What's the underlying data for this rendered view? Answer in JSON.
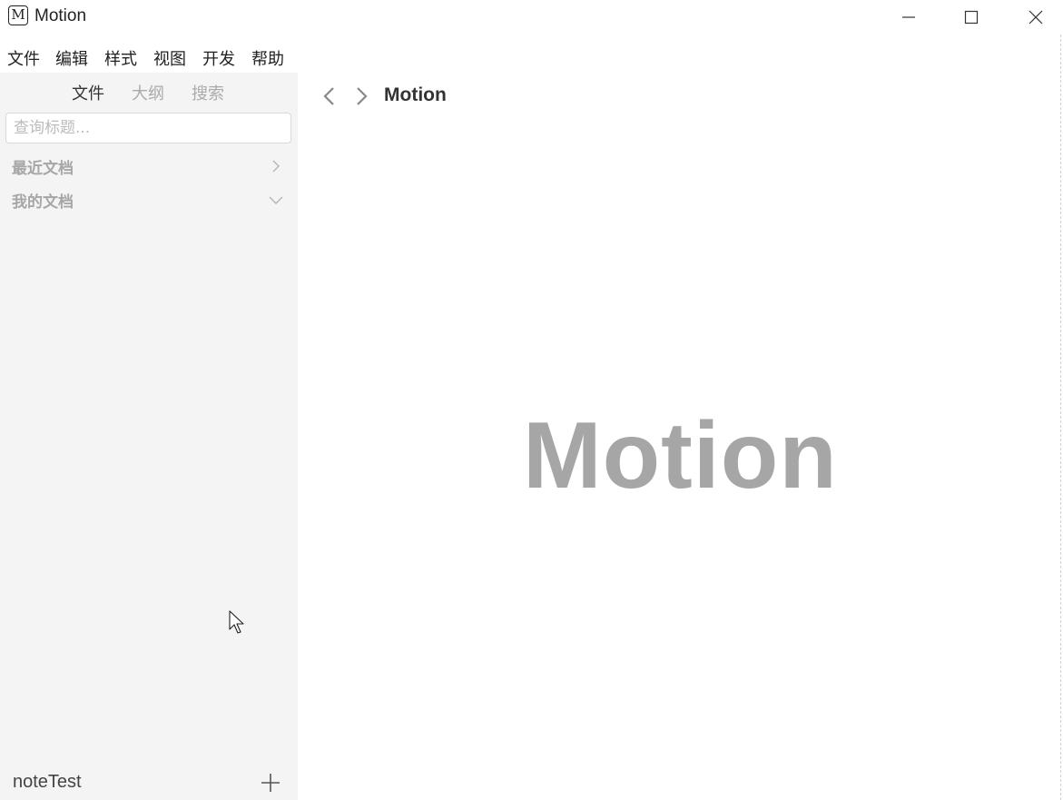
{
  "window": {
    "app_icon_letter": "M",
    "title": "Motion"
  },
  "menu": {
    "items": [
      "文件",
      "编辑",
      "样式",
      "视图",
      "开发",
      "帮助"
    ]
  },
  "sidebar": {
    "tabs": [
      {
        "label": "文件",
        "active": true
      },
      {
        "label": "大纲",
        "active": false
      },
      {
        "label": "搜索",
        "active": false
      }
    ],
    "search": {
      "placeholder": "查询标题...",
      "value": ""
    },
    "sections": [
      {
        "label": "最近文档",
        "state": "collapsed"
      },
      {
        "label": "我的文档",
        "state": "expanded"
      }
    ],
    "workspace_name": "noteTest"
  },
  "main": {
    "doc_title": "Motion",
    "splash_text": "Motion"
  },
  "colors": {
    "sidebar_bg": "#f4f4f4",
    "muted_text": "#a6a6a6",
    "inactive_tab": "#aaaaaa"
  }
}
